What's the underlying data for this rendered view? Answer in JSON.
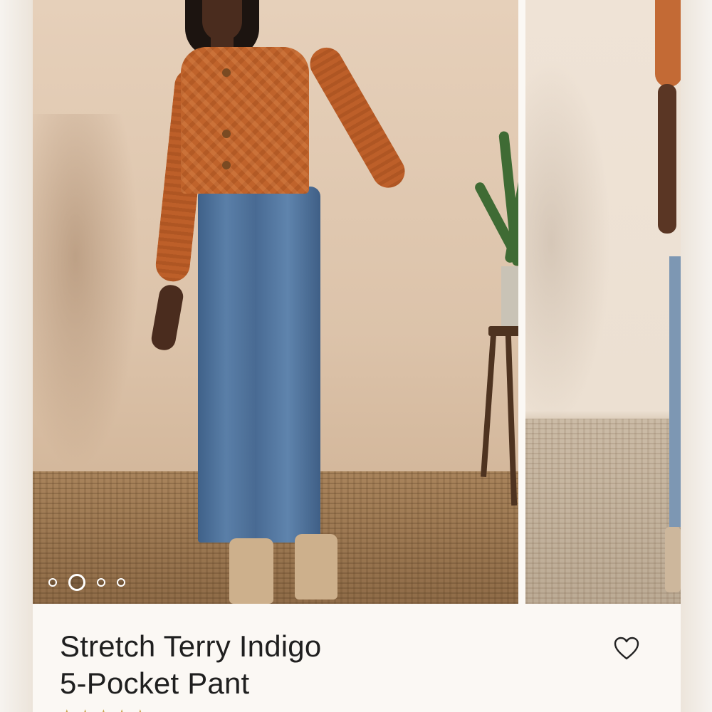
{
  "product": {
    "title_line1": "Stretch Terry Indigo",
    "title_line2": "5-Pocket Pant"
  },
  "carousel": {
    "slide_count": 4,
    "active_slide": 2
  },
  "icons": {
    "favorite": "heart-outline-icon",
    "rating": "star-icon"
  },
  "colors": {
    "sweater": "#c0632b",
    "denim": "#4f74a0",
    "rating_star": "#c9a34d"
  }
}
